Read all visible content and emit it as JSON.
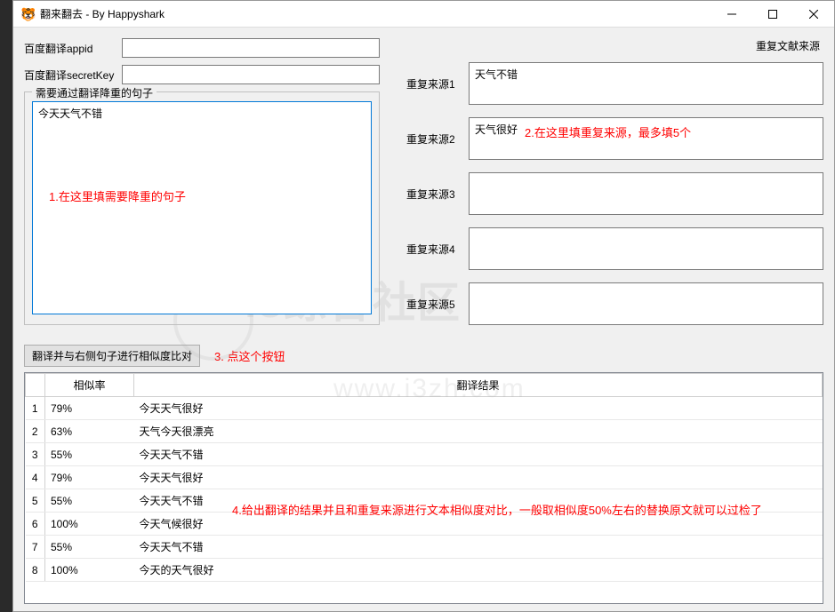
{
  "window": {
    "title": "翻来翻去 - By Happyshark",
    "icon": "🐯"
  },
  "left": {
    "appid_label": "百度翻译appid",
    "appid_value": "",
    "secret_label": "百度翻译secretKey",
    "secret_value": "",
    "group_title": "需要通过翻译降重的句子",
    "textarea_value": "今天天气不错"
  },
  "right": {
    "header": "重复文献来源",
    "rows": [
      {
        "label": "重复来源1",
        "value": "天气不错"
      },
      {
        "label": "重复来源2",
        "value": "天气很好"
      },
      {
        "label": "重复来源3",
        "value": ""
      },
      {
        "label": "重复来源4",
        "value": ""
      },
      {
        "label": "重复来源5",
        "value": ""
      }
    ]
  },
  "action": {
    "button": "翻译并与右侧句子进行相似度比对"
  },
  "annotations": {
    "a1": "1.在这里填需要降重的句子",
    "a2": "2.在这里填重复来源，最多填5个",
    "a3": "3. 点这个按钮",
    "a4": "4.给出翻译的结果并且和重复来源进行文本相似度对比，一般取相似度50%左右的替换原文就可以过检了"
  },
  "table": {
    "col_index": "",
    "col_similarity": "相似率",
    "col_result": "翻译结果",
    "rows": [
      {
        "idx": "1",
        "sim": "79%",
        "res": "今天天气很好"
      },
      {
        "idx": "2",
        "sim": "63%",
        "res": "天气今天很漂亮"
      },
      {
        "idx": "3",
        "sim": "55%",
        "res": "今天天气不错"
      },
      {
        "idx": "4",
        "sim": "79%",
        "res": "今天天气很好"
      },
      {
        "idx": "5",
        "sim": "55%",
        "res": "今天天气不错"
      },
      {
        "idx": "6",
        "sim": "100%",
        "res": "今天气候很好"
      },
      {
        "idx": "7",
        "sim": "55%",
        "res": "今天天气不错"
      },
      {
        "idx": "8",
        "sim": "100%",
        "res": "今天的天气很好"
      }
    ]
  },
  "watermark": {
    "text": "i3综合社区",
    "url": "www.i3zh.com"
  }
}
